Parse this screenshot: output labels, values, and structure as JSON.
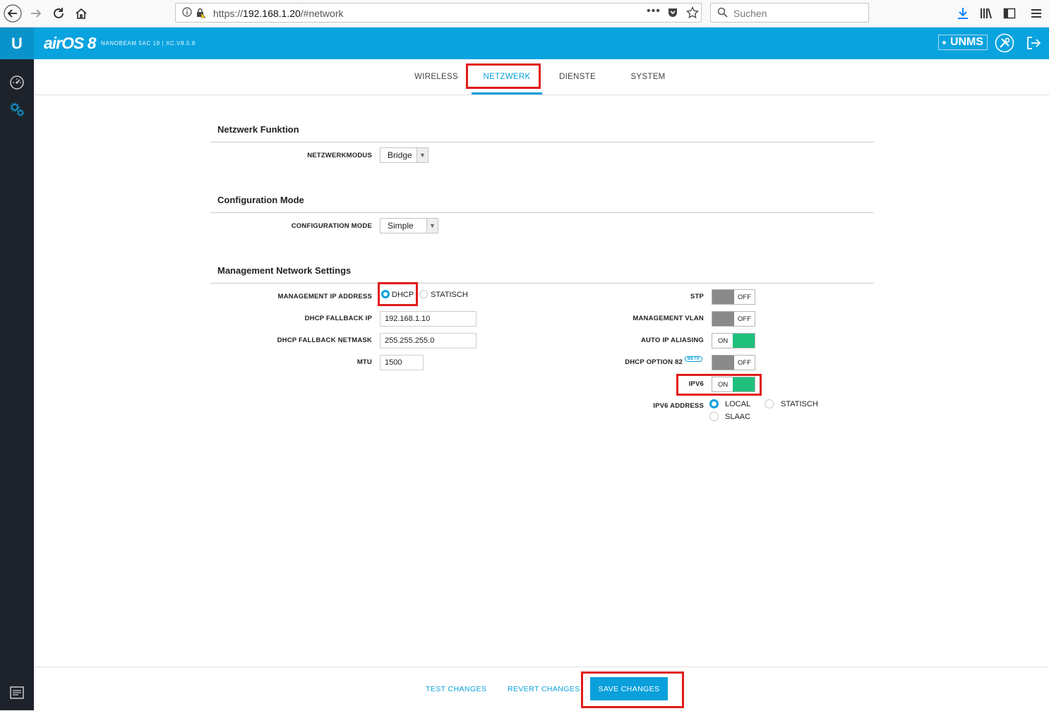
{
  "browser": {
    "url_prefix": "https://",
    "url_host": "192.168.1.20",
    "url_path": "/#network",
    "search_placeholder": "Suchen"
  },
  "header": {
    "logo": "U",
    "product": "airOS 8",
    "device_info": "NANOBEAM 5AC 19 | XC.V8.5.8",
    "unms_label": "UNMS",
    "brand_color": "#09a3df"
  },
  "tabs": [
    {
      "label": "WIRELESS"
    },
    {
      "label": "NETZWERK",
      "active": true
    },
    {
      "label": "DIENSTE"
    },
    {
      "label": "SYSTEM"
    }
  ],
  "sections": {
    "netzwerk_funktion": {
      "title": "Netzwerk Funktion",
      "mode_label": "NETZWERKMODUS",
      "mode_value": "Bridge"
    },
    "configuration_mode": {
      "title": "Configuration Mode",
      "mode_label": "CONFIGURATION MODE",
      "mode_value": "Simple"
    },
    "management": {
      "title": "Management Network Settings",
      "ip_address_label": "MANAGEMENT IP ADDRESS",
      "ip_options": {
        "dhcp": "DHCP",
        "static": "STATISCH",
        "selected": "DHCP"
      },
      "fallback_ip_label": "DHCP FALLBACK IP",
      "fallback_ip_value": "192.168.1.10",
      "fallback_netmask_label": "DHCP FALLBACK NETMASK",
      "fallback_netmask_value": "255.255.255.0",
      "mtu_label": "MTU",
      "mtu_value": "1500",
      "stp_label": "STP",
      "stp_state": "OFF",
      "vlan_label": "MANAGEMENT VLAN",
      "vlan_state": "OFF",
      "auto_ip_label": "AUTO IP ALIASING",
      "auto_ip_state": "ON",
      "dhcp82_label": "DHCP OPTION 82",
      "dhcp82_badge": "BETA",
      "dhcp82_state": "OFF",
      "ipv6_label": "IPV6",
      "ipv6_state": "ON",
      "ipv6_address_label": "IPV6 ADDRESS",
      "ipv6_options": {
        "local": "LOCAL",
        "static": "STATISCH",
        "slaac": "SLAAC",
        "selected": "LOCAL"
      }
    }
  },
  "footer": {
    "test_label": "TEST CHANGES",
    "revert_label": "REVERT CHANGES",
    "save_label": "SAVE CHANGES"
  }
}
